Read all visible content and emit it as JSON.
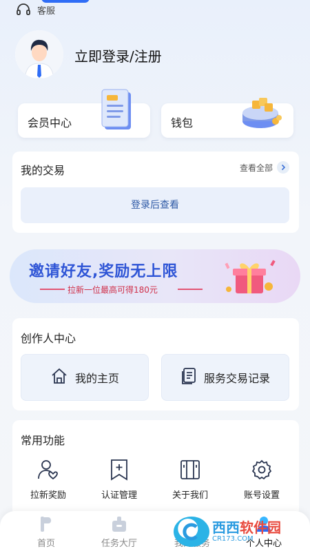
{
  "header": {
    "support_label": "客服"
  },
  "profile": {
    "login_title": "立即登录/注册"
  },
  "features": {
    "member_center": "会员中心",
    "wallet": "钱包"
  },
  "trades": {
    "title": "我的交易",
    "view_all": "查看全部",
    "login_to_view": "登录后查看"
  },
  "banner": {
    "title": "邀请好友,奖励无上限",
    "subtitle": "拉新一位最高可得180元"
  },
  "creator": {
    "title": "创作人中心",
    "home": "我的主页",
    "records": "服务交易记录"
  },
  "common": {
    "title": "常用功能",
    "items": [
      {
        "label": "拉新奖励",
        "icon": "user-heart-icon"
      },
      {
        "label": "认证管理",
        "icon": "bookmark-plus-icon"
      },
      {
        "label": "关于我们",
        "icon": "book-icon"
      },
      {
        "label": "账号设置",
        "icon": "gear-icon"
      }
    ]
  },
  "nav": {
    "items": [
      {
        "label": "首页"
      },
      {
        "label": "任务大厅"
      },
      {
        "label": "我的服务"
      },
      {
        "label": "个人中心"
      }
    ]
  },
  "watermark": {
    "brand": "西西",
    "brand_suffix": "软件园",
    "url": "CR173.COM"
  },
  "colors": {
    "accent": "#2f6df6",
    "banner_title": "#2f55d6",
    "banner_sub": "#d0304a"
  }
}
